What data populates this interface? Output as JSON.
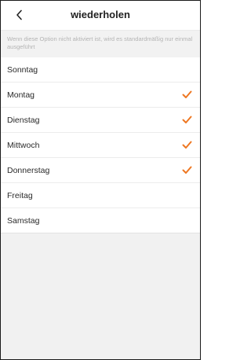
{
  "header": {
    "back_icon": "chevron-left-icon",
    "title": "wiederholen"
  },
  "hint": "Wenn diese Option nicht aktiviert ist, wird es standardmäßig nur einmal ausgeführt",
  "accent_color": "#ee7722",
  "days": [
    {
      "label": "Sonntag",
      "checked": false
    },
    {
      "label": "Montag",
      "checked": true
    },
    {
      "label": "Dienstag",
      "checked": true
    },
    {
      "label": "Mittwoch",
      "checked": true
    },
    {
      "label": "Donnerstag",
      "checked": true
    },
    {
      "label": "Freitag",
      "checked": false
    },
    {
      "label": "Samstag",
      "checked": false
    }
  ]
}
